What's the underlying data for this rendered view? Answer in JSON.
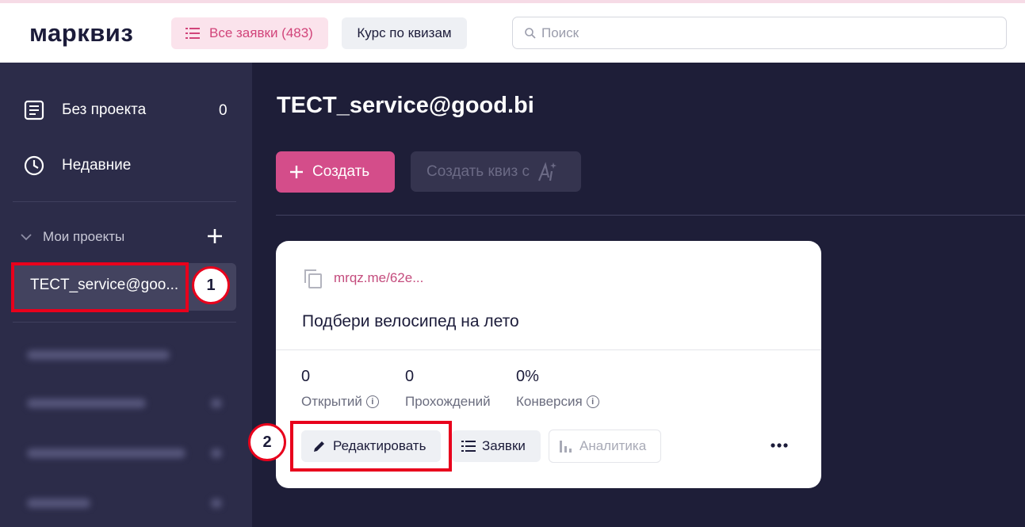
{
  "header": {
    "logo": "марквиз",
    "requests_button": "Все заявки (483)",
    "course_button": "Курс по квизам",
    "search_placeholder": "Поиск"
  },
  "sidebar": {
    "no_project": {
      "label": "Без проекта",
      "count": "0"
    },
    "recent": {
      "label": "Недавние"
    },
    "my_projects": "Мои проекты",
    "active_project": "TECT_service@goo..."
  },
  "main": {
    "title": "TECT_service@good.bi",
    "create_button": "Создать",
    "create_ai_button": "Создать квиз с"
  },
  "card": {
    "link": "mrqz.me/62e...",
    "title": "Подбери велосипед на лето",
    "stats": [
      {
        "value": "0",
        "label": "Открытий"
      },
      {
        "value": "0",
        "label": "Прохождений"
      },
      {
        "value": "0%",
        "label": "Конверсия"
      }
    ],
    "edit_button": "Редактировать",
    "leads_button": "Заявки",
    "analytics_button": "Аналитика"
  },
  "annotations": {
    "badge1": "1",
    "badge2": "2"
  },
  "colors": {
    "accent": "#d44d8a",
    "highlight": "#e8001c",
    "sidebar": "#2c2c49",
    "main_bg": "#1e1e38"
  }
}
